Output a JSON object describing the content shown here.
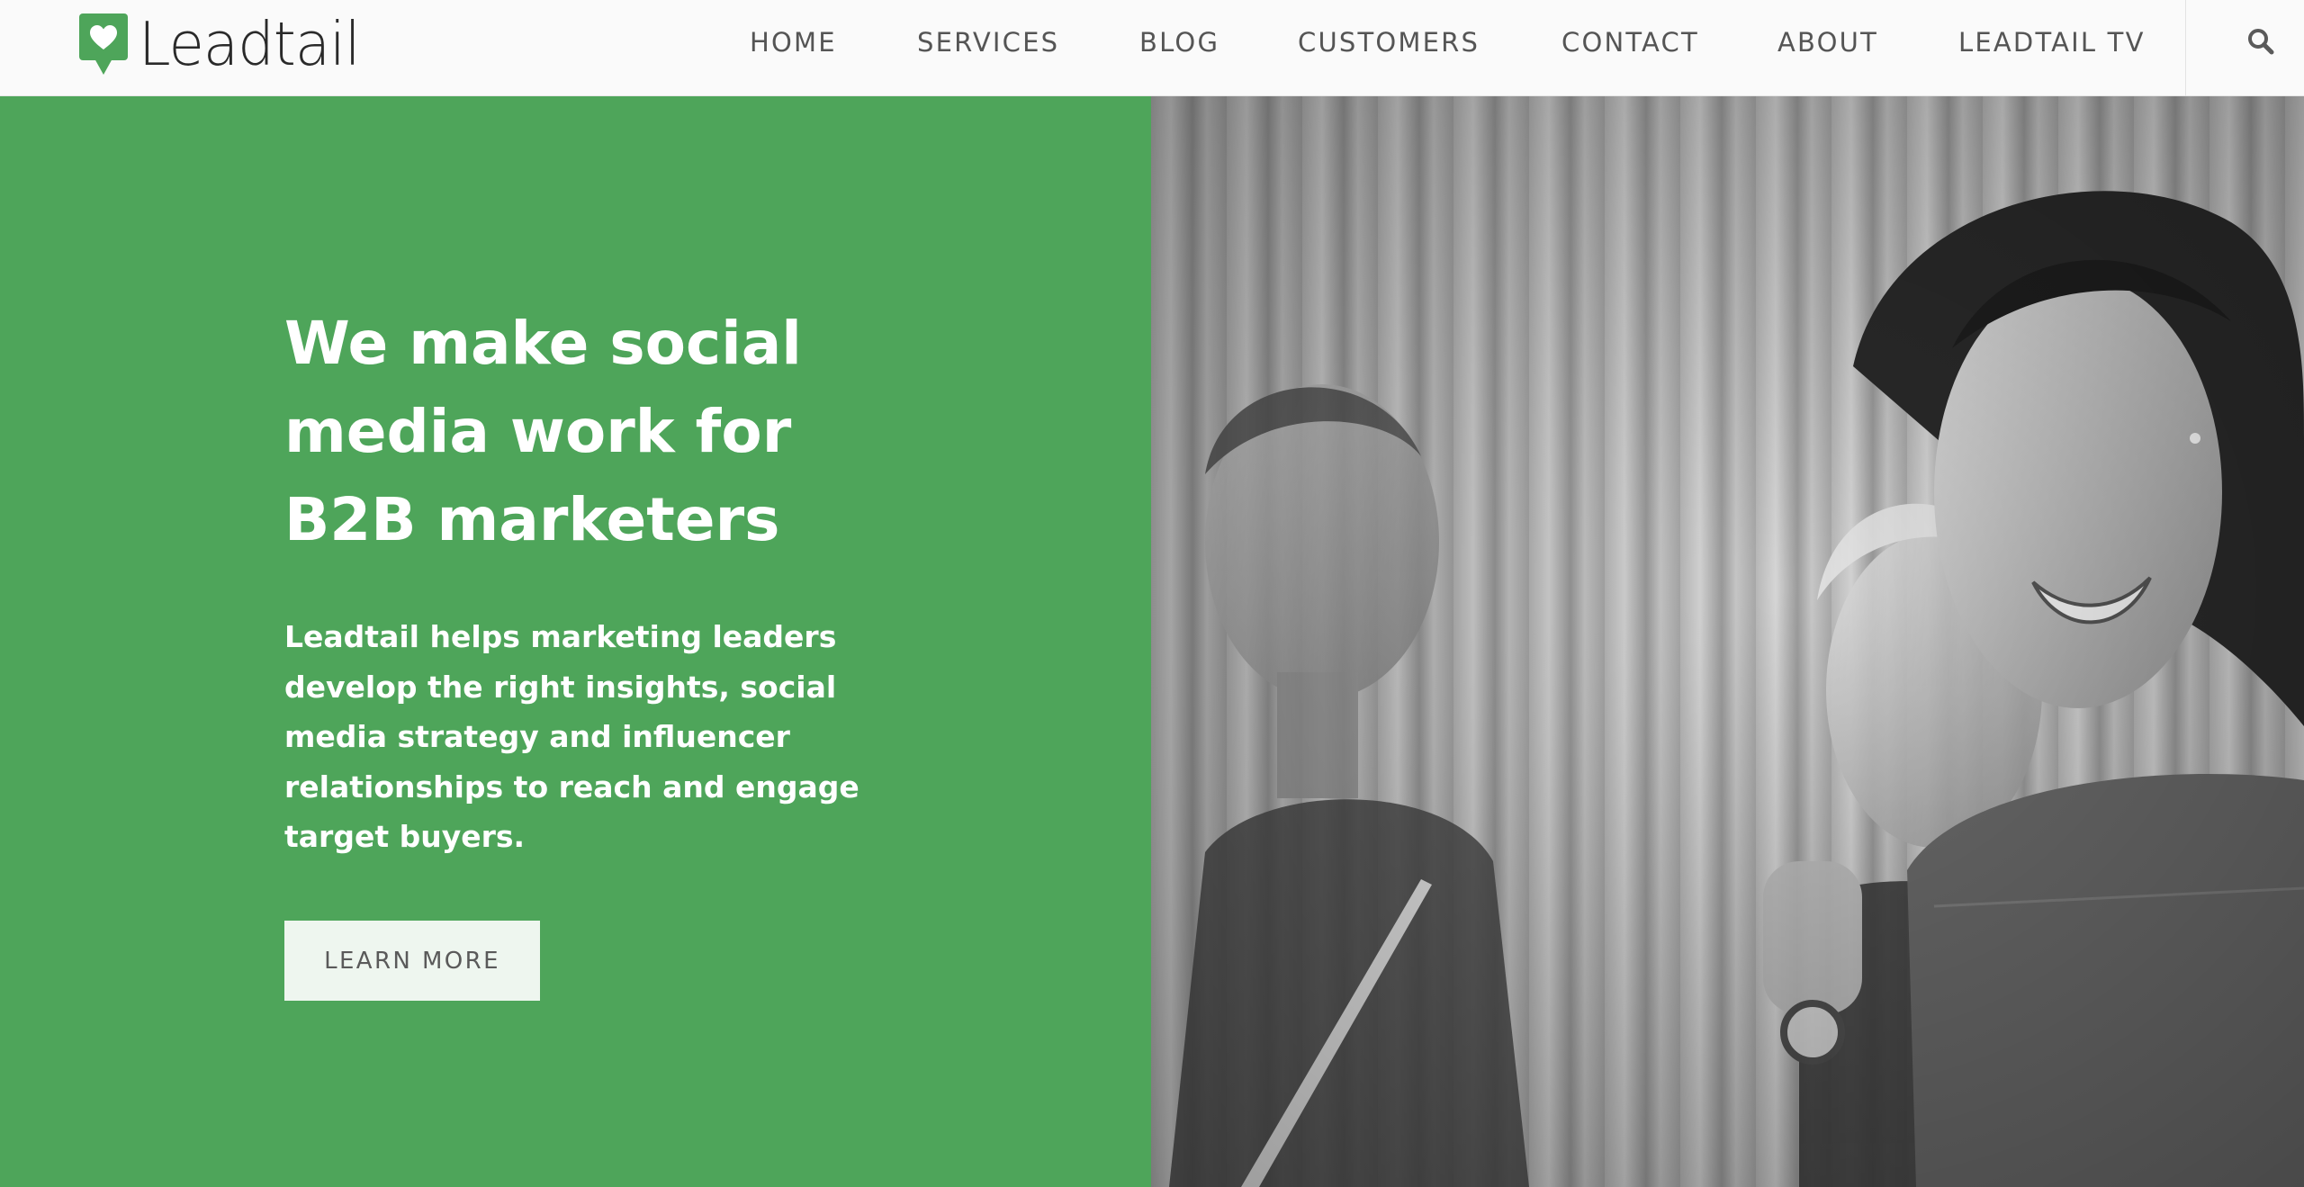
{
  "brand": {
    "name": "Leadtail",
    "accent_color": "#4ea55a",
    "icon": "heart-speech-bubble-icon"
  },
  "nav": {
    "items": [
      {
        "label": "HOME"
      },
      {
        "label": "SERVICES"
      },
      {
        "label": "BLOG"
      },
      {
        "label": "CUSTOMERS"
      },
      {
        "label": "CONTACT"
      },
      {
        "label": "ABOUT"
      },
      {
        "label": "LEADTAIL TV"
      }
    ],
    "search_icon": "search-icon"
  },
  "hero": {
    "title": "We make social media work for B2B marketers",
    "description": "Leadtail helps marketing leaders develop the right insights, social media strategy and influencer relationships to reach and engage target buyers.",
    "cta_label": "LEARN MORE",
    "image_alt": "Black-and-white photo of smiling colleagues looking at a laptop"
  }
}
